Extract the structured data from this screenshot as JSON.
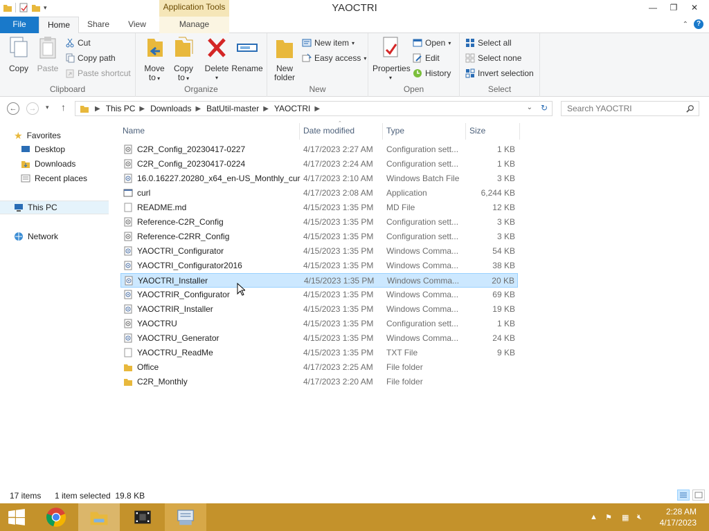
{
  "window": {
    "title": "YAOCTRI",
    "contextual_tab_group": "Application Tools",
    "controls": {
      "minimize": "—",
      "restore": "❐",
      "close": "✕"
    }
  },
  "ribbon": {
    "tabs": [
      "File",
      "Home",
      "Share",
      "View",
      "Manage"
    ],
    "help": "?",
    "groups": {
      "clipboard": {
        "label": "Clipboard",
        "copy": "Copy",
        "paste": "Paste",
        "cut": "Cut",
        "copy_path": "Copy path",
        "paste_shortcut": "Paste shortcut"
      },
      "organize": {
        "label": "Organize",
        "move_to": "Move",
        "move_to_2": "to",
        "copy_to": "Copy",
        "copy_to_2": "to",
        "delete": "Delete",
        "rename": "Rename"
      },
      "new": {
        "label": "New",
        "new_folder": "New",
        "new_folder_2": "folder",
        "new_item": "New item",
        "easy_access": "Easy access"
      },
      "open": {
        "label": "Open",
        "properties": "Properties",
        "open": "Open",
        "edit": "Edit",
        "history": "History"
      },
      "select": {
        "label": "Select",
        "select_all": "Select all",
        "select_none": "Select none",
        "invert_selection": "Invert selection"
      }
    }
  },
  "address": {
    "crumbs": [
      "This PC",
      "Downloads",
      "BatUtil-master",
      "YAOCTRI"
    ],
    "search_placeholder": "Search YAOCTRI"
  },
  "nav_pane": {
    "favorites": "Favorites",
    "desktop": "Desktop",
    "downloads": "Downloads",
    "recent_places": "Recent places",
    "this_pc": "This PC",
    "network": "Network"
  },
  "columns": {
    "name": "Name",
    "date": "Date modified",
    "type": "Type",
    "size": "Size"
  },
  "files": [
    {
      "name": "C2R_Config_20230417-0227",
      "date": "4/17/2023 2:27 AM",
      "type": "Configuration sett...",
      "size": "1 KB",
      "icon": "config-file-icon"
    },
    {
      "name": "C2R_Config_20230417-0224",
      "date": "4/17/2023 2:24 AM",
      "type": "Configuration sett...",
      "size": "1 KB",
      "icon": "config-file-icon"
    },
    {
      "name": "16.0.16227.20280_x64_en-US_Monthly_curl",
      "date": "4/17/2023 2:10 AM",
      "type": "Windows Batch File",
      "size": "3 KB",
      "icon": "batch-file-icon"
    },
    {
      "name": "curl",
      "date": "4/17/2023 2:08 AM",
      "type": "Application",
      "size": "6,244 KB",
      "icon": "application-icon"
    },
    {
      "name": "README.md",
      "date": "4/15/2023 1:35 PM",
      "type": "MD File",
      "size": "12 KB",
      "icon": "text-file-icon"
    },
    {
      "name": "Reference-C2R_Config",
      "date": "4/15/2023 1:35 PM",
      "type": "Configuration sett...",
      "size": "3 KB",
      "icon": "config-file-icon"
    },
    {
      "name": "Reference-C2RR_Config",
      "date": "4/15/2023 1:35 PM",
      "type": "Configuration sett...",
      "size": "3 KB",
      "icon": "config-file-icon"
    },
    {
      "name": "YAOCTRI_Configurator",
      "date": "4/15/2023 1:35 PM",
      "type": "Windows Comma...",
      "size": "54 KB",
      "icon": "batch-file-icon"
    },
    {
      "name": "YAOCTRI_Configurator2016",
      "date": "4/15/2023 1:35 PM",
      "type": "Windows Comma...",
      "size": "38 KB",
      "icon": "batch-file-icon"
    },
    {
      "name": "YAOCTRI_Installer",
      "date": "4/15/2023 1:35 PM",
      "type": "Windows Comma...",
      "size": "20 KB",
      "icon": "batch-file-icon",
      "selected": true
    },
    {
      "name": "YAOCTRIR_Configurator",
      "date": "4/15/2023 1:35 PM",
      "type": "Windows Comma...",
      "size": "69 KB",
      "icon": "batch-file-icon"
    },
    {
      "name": "YAOCTRIR_Installer",
      "date": "4/15/2023 1:35 PM",
      "type": "Windows Comma...",
      "size": "19 KB",
      "icon": "batch-file-icon"
    },
    {
      "name": "YAOCTRU",
      "date": "4/15/2023 1:35 PM",
      "type": "Configuration sett...",
      "size": "1 KB",
      "icon": "config-file-icon"
    },
    {
      "name": "YAOCTRU_Generator",
      "date": "4/15/2023 1:35 PM",
      "type": "Windows Comma...",
      "size": "24 KB",
      "icon": "batch-file-icon"
    },
    {
      "name": "YAOCTRU_ReadMe",
      "date": "4/15/2023 1:35 PM",
      "type": "TXT File",
      "size": "9 KB",
      "icon": "text-file-icon"
    },
    {
      "name": "Office",
      "date": "4/17/2023 2:25 AM",
      "type": "File folder",
      "size": "",
      "icon": "folder-icon"
    },
    {
      "name": "C2R_Monthly",
      "date": "4/17/2023 2:20 AM",
      "type": "File folder",
      "size": "",
      "icon": "folder-icon"
    }
  ],
  "status": {
    "item_count": "17 items",
    "selection": "1 item selected  19.8 KB"
  },
  "taskbar": {
    "time": "2:28 AM",
    "date": "4/17/2023"
  },
  "colors": {
    "accent": "#1979ca",
    "selection_bg": "#cce8ff",
    "selection_border": "#99d1ff",
    "taskbar": "#c4922b",
    "contextual_tab": "#f5e6b8"
  }
}
